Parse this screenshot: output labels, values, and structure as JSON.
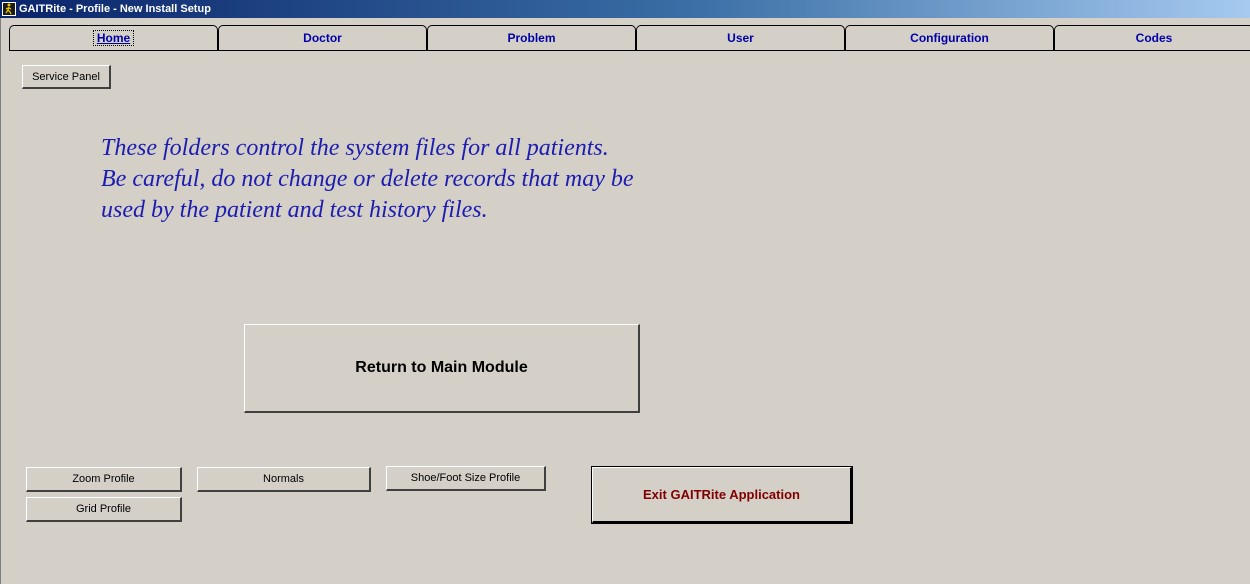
{
  "window": {
    "title": "GAITRite - Profile - New Install Setup"
  },
  "tabs": [
    {
      "label": "Home",
      "active": true
    },
    {
      "label": "Doctor",
      "active": false
    },
    {
      "label": "Problem",
      "active": false
    },
    {
      "label": "User",
      "active": false
    },
    {
      "label": "Configuration",
      "active": false
    },
    {
      "label": "Codes",
      "active": false
    }
  ],
  "service_panel_label": "Service Panel",
  "warning_lines": [
    "These folders control the system files for all patients.",
    "Be careful, do not change or delete records that may be",
    "used by the patient and test history files."
  ],
  "return_label": "Return to Main Module",
  "profile_buttons": {
    "zoom": "Zoom Profile",
    "normals": "Normals",
    "shoe": "Shoe/Foot Size Profile",
    "grid": "Grid Profile"
  },
  "exit_label": "Exit GAITRite Application",
  "colors": {
    "tab_text": "#0000aa",
    "warning_text": "#1c1cb0",
    "exit_text": "#800000",
    "background": "#d4d0c8"
  }
}
